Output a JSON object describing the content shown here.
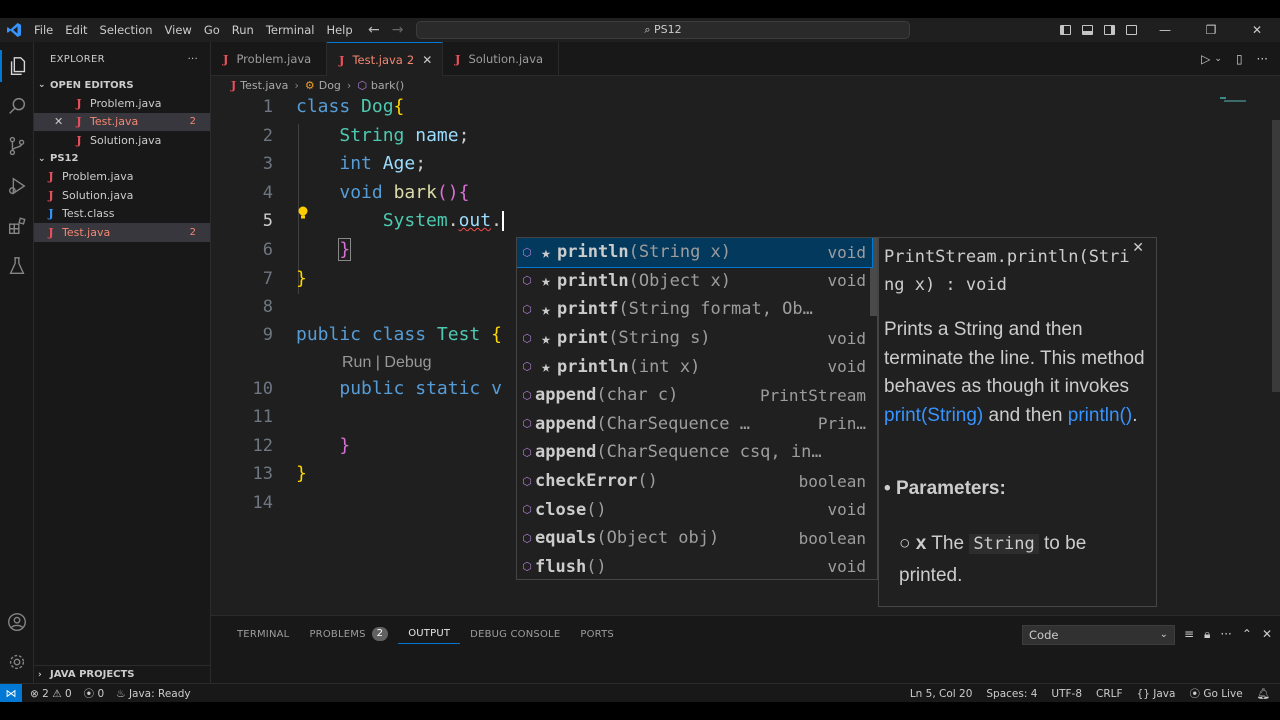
{
  "window": {
    "command_center": "PS12",
    "menu": [
      "File",
      "Edit",
      "Selection",
      "View",
      "Go",
      "Run",
      "Terminal",
      "Help"
    ]
  },
  "sidebar": {
    "title": "EXPLORER",
    "more": "···",
    "open_editors_title": "OPEN EDITORS",
    "open_editors": [
      {
        "name": "Problem.java",
        "badge": ""
      },
      {
        "name": "Test.java",
        "badge": "2"
      },
      {
        "name": "Solution.java",
        "badge": ""
      }
    ],
    "folder_title": "PS12",
    "files": [
      {
        "name": "Problem.java",
        "badge": ""
      },
      {
        "name": "Solution.java",
        "badge": ""
      },
      {
        "name": "Test.class",
        "badge": ""
      },
      {
        "name": "Test.java",
        "badge": "2"
      }
    ],
    "java_projects": "JAVA PROJECTS"
  },
  "tabs": [
    {
      "name": "Problem.java",
      "badge": ""
    },
    {
      "name": "Test.java",
      "badge": "2"
    },
    {
      "name": "Solution.java",
      "badge": ""
    }
  ],
  "breadcrumb": {
    "file": "Test.java",
    "class": "Dog",
    "method": "bark()"
  },
  "editor": {
    "line_numbers": [
      "1",
      "2",
      "3",
      "4",
      "5",
      "6",
      "7",
      "8",
      "9",
      "10",
      "11",
      "12",
      "13",
      "14"
    ],
    "codelens": "Run | Debug"
  },
  "suggest": {
    "items": [
      {
        "star": "★",
        "method": "println",
        "sig": "(String x)",
        "type": "void"
      },
      {
        "star": "★",
        "method": "println",
        "sig": "(Object x)",
        "type": "void"
      },
      {
        "star": "★",
        "method": "printf",
        "sig": "(String format, Ob…",
        "type": ""
      },
      {
        "star": "★",
        "method": "print",
        "sig": "(String s)",
        "type": "void"
      },
      {
        "star": "★",
        "method": "println",
        "sig": "(int x)",
        "type": "void"
      },
      {
        "star": "",
        "method": "append",
        "sig": "(char c)",
        "type": "PrintStream"
      },
      {
        "star": "",
        "method": "append",
        "sig": "(CharSequence …",
        "type": "Prin…"
      },
      {
        "star": "",
        "method": "append",
        "sig": "(CharSequence csq, in…",
        "type": ""
      },
      {
        "star": "",
        "method": "checkError",
        "sig": "()",
        "type": "boolean"
      },
      {
        "star": "",
        "method": "close",
        "sig": "()",
        "type": "void"
      },
      {
        "star": "",
        "method": "equals",
        "sig": "(Object obj)",
        "type": "boolean"
      },
      {
        "star": "",
        "method": "flush",
        "sig": "()",
        "type": "void"
      }
    ]
  },
  "details": {
    "signature": "PrintStream.println(String x) : void",
    "doc_1": "Prints a String and then terminate the line. This method behaves as though it invokes ",
    "doc_link_1": "print(String)",
    "doc_2": " and then ",
    "doc_link_2": "println()",
    "doc_3": ".",
    "params_title": "Parameters:",
    "param_name": "x",
    "param_text_1": " The ",
    "param_code": "String",
    "param_text_2": " to be printed."
  },
  "panel": {
    "tabs": [
      "TERMINAL",
      "PROBLEMS",
      "OUTPUT",
      "DEBUG CONSOLE",
      "PORTS"
    ],
    "problems_badge": "2",
    "select_value": "Code"
  },
  "status": {
    "errors": "2",
    "warnings": "0",
    "ports": "0",
    "java": "Java: Ready",
    "position": "Ln 5, Col 20",
    "spaces": "Spaces: 4",
    "encoding": "UTF-8",
    "eol": "CRLF",
    "language": "Java",
    "golive": "Go Live"
  },
  "colors": {
    "accent": "#0078d4",
    "error": "#f48771",
    "java_icon": "#e8505b"
  }
}
